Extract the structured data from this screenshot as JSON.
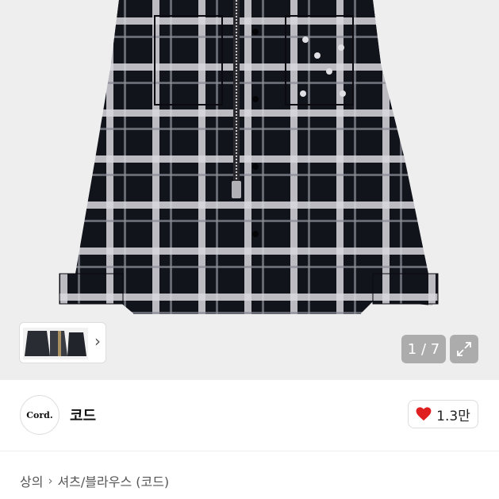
{
  "gallery": {
    "counter": "1 / 7",
    "thumb_alt": "shirt-thumbnails",
    "expand_icon": "expand-icon",
    "colors": {
      "fabric": "#12141c",
      "check": "#d9d9de",
      "background": "#eeeeee"
    }
  },
  "seller": {
    "avatar_text": "Cord.",
    "name": "코드"
  },
  "like": {
    "count": "1.3만",
    "color": "#e02020"
  },
  "breadcrumb": {
    "category": "상의",
    "subcategory": "셔츠/블라우스 (코드)"
  }
}
